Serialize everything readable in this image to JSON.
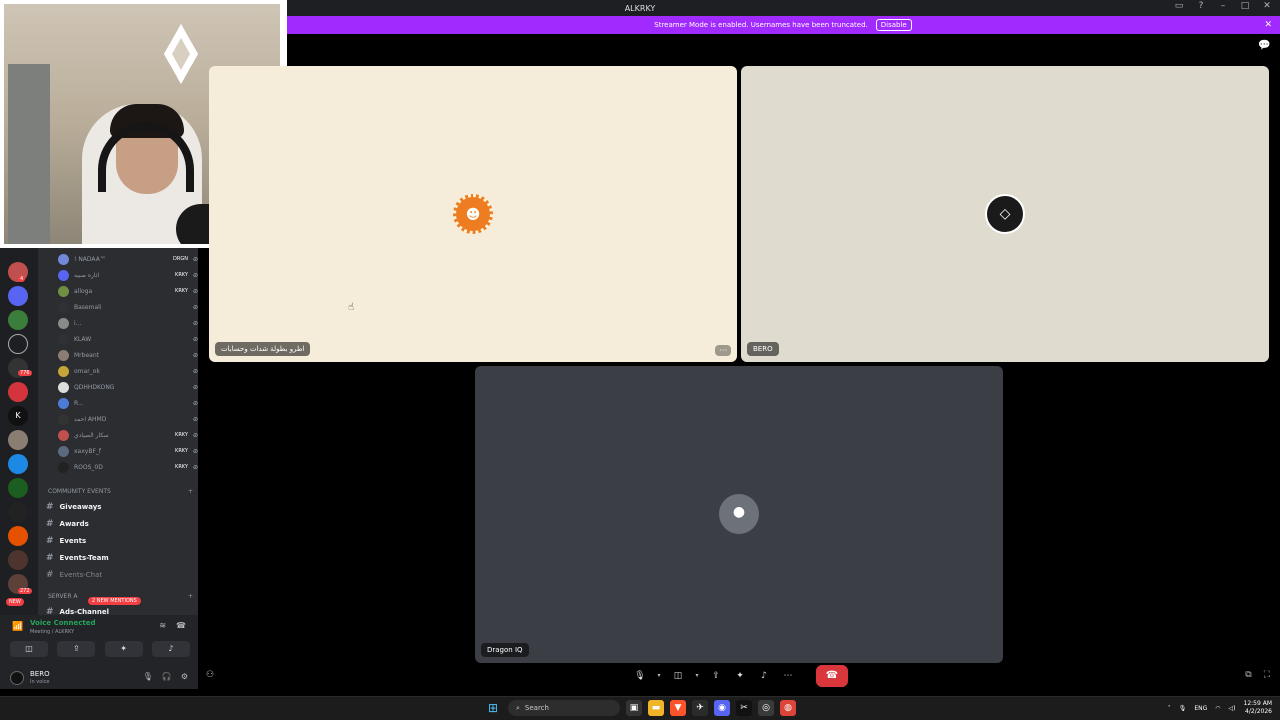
{
  "window": {
    "title": "ALKRKY"
  },
  "banner": {
    "text": "Streamer Mode is enabled. Usernames have been truncated.",
    "disable_label": "Disable"
  },
  "voice_members": [
    {
      "name": "! NADAA™",
      "tag": "DRGN",
      "color": "#7289da"
    },
    {
      "name": "اثاره صبيه",
      "tag": "KRKY",
      "color": "#5865f2"
    },
    {
      "name": "alloga",
      "tag": "KRKY",
      "color": "#6f8f43"
    },
    {
      "name": "Basemali",
      "tag": "",
      "color": "#2f3136"
    },
    {
      "name": "i...",
      "tag": "",
      "color": "#8a8a8a"
    },
    {
      "name": "KLAW",
      "tag": "",
      "color": "#2f3136"
    },
    {
      "name": "Mrbeant",
      "tag": "",
      "color": "#8a7d72"
    },
    {
      "name": "omar_ok",
      "tag": "",
      "color": "#c4a53a"
    },
    {
      "name": "QDHHDKONG",
      "tag": "",
      "color": "#ddd"
    },
    {
      "name": "R...",
      "tag": "",
      "color": "#4f7bd8"
    },
    {
      "name": "احمد AHMD",
      "tag": "",
      "color": "#333"
    },
    {
      "name": "سكار الصيادي",
      "tag": "KRKY",
      "color": "#c0504d"
    },
    {
      "name": "xaxyBF_f",
      "tag": "KRKY",
      "color": "#5a6b7d"
    },
    {
      "name": "ROOS_0D",
      "tag": "KRKY",
      "color": "#222"
    }
  ],
  "category": {
    "name": "COMMUNITY EVENTS"
  },
  "channels": [
    {
      "label": "Giveaways"
    },
    {
      "label": "Awards"
    },
    {
      "label": "Events"
    },
    {
      "label": "Events-Team"
    },
    {
      "label": "Events-Chat"
    }
  ],
  "server_category": {
    "name": "SERVER A",
    "sub": "Ads-Channel"
  },
  "mentions_label": "2 NEW MENTIONS",
  "new_label": "NEW",
  "server_badges": [
    "4",
    "776",
    "272"
  ],
  "voice": {
    "status": "Voice Connected",
    "channel": "Meeting / ALKRKY"
  },
  "user": {
    "name": "BERO",
    "status": "In voice"
  },
  "tiles": {
    "left_name": "اطرو بطولة شدات وحسابات",
    "right_name": "BERO",
    "bottom_name": "Dragon IQ",
    "more_label": "···"
  },
  "taskbar": {
    "search_placeholder": "Search",
    "lang": "ENG",
    "time": "12:59 AM",
    "date": "4/2/2026"
  },
  "colors": {
    "accent": "#a12bff",
    "hangup": "#da373c",
    "voice_green": "#23a55a",
    "discord_blue": "#5865f2"
  },
  "icons": [
    "chat-icon",
    "mic-icon",
    "camera-icon",
    "screenshare-icon",
    "activities-icon",
    "soundboard-icon",
    "more-icon",
    "hangup-icon",
    "popout-icon",
    "fullscreen-icon"
  ]
}
